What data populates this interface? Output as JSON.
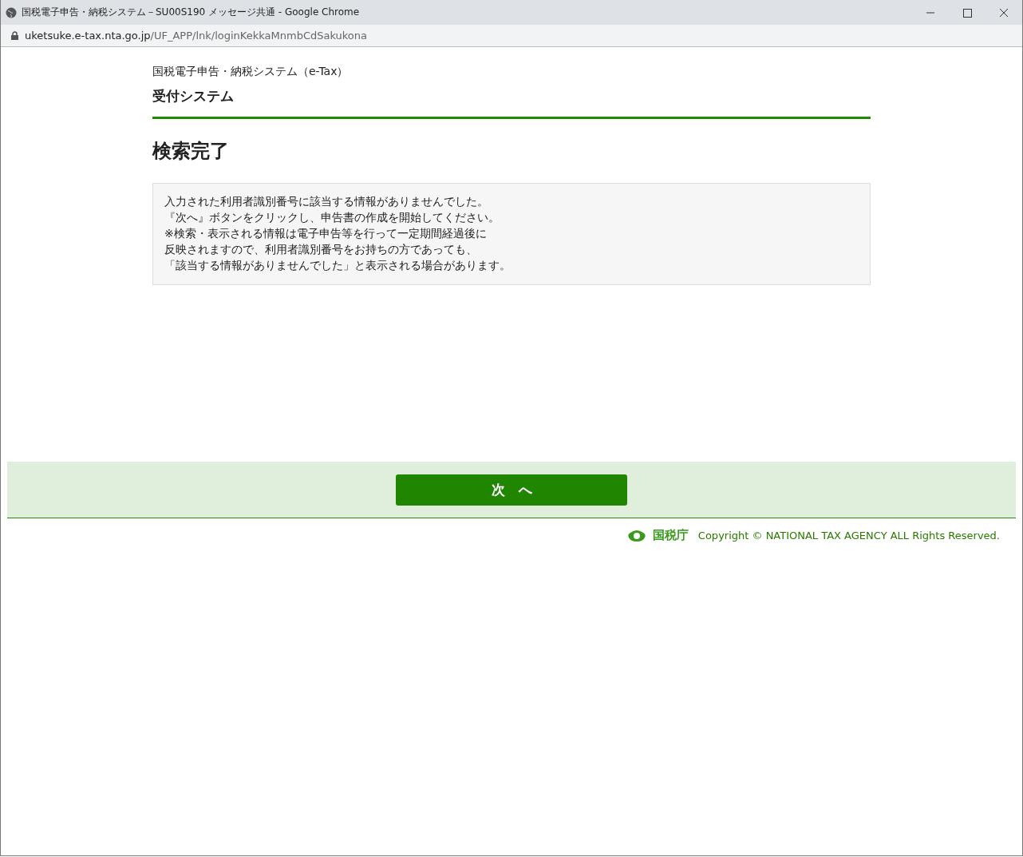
{
  "window": {
    "title": "国税電子申告・納税システム－SU00S190 メッセージ共通 - Google Chrome",
    "url_host": "uketsuke.e-tax.nta.go.jp",
    "url_path": "/UF_APP/lnk/loginKekkaMnmbCdSakukona"
  },
  "header": {
    "system_name": "国税電子申告・納税システム（e-Tax）",
    "subtitle": "受付システム"
  },
  "page_title": "検索完了",
  "message_lines": [
    "入力された利用者識別番号に該当する情報がありませんでした。",
    "『次へ』ボタンをクリックし、申告書の作成を開始してください。",
    "※検索・表示される情報は電子申告等を行って一定期間経過後に",
    "反映されますので、利用者識別番号をお持ちの方であっても、",
    "「該当する情報がありませんでした」と表示される場合があります。"
  ],
  "next_button": "次　へ",
  "footer": {
    "agency": "国税庁",
    "copyright": "Copyright © NATIONAL TAX AGENCY ALL Rights Reserved."
  }
}
